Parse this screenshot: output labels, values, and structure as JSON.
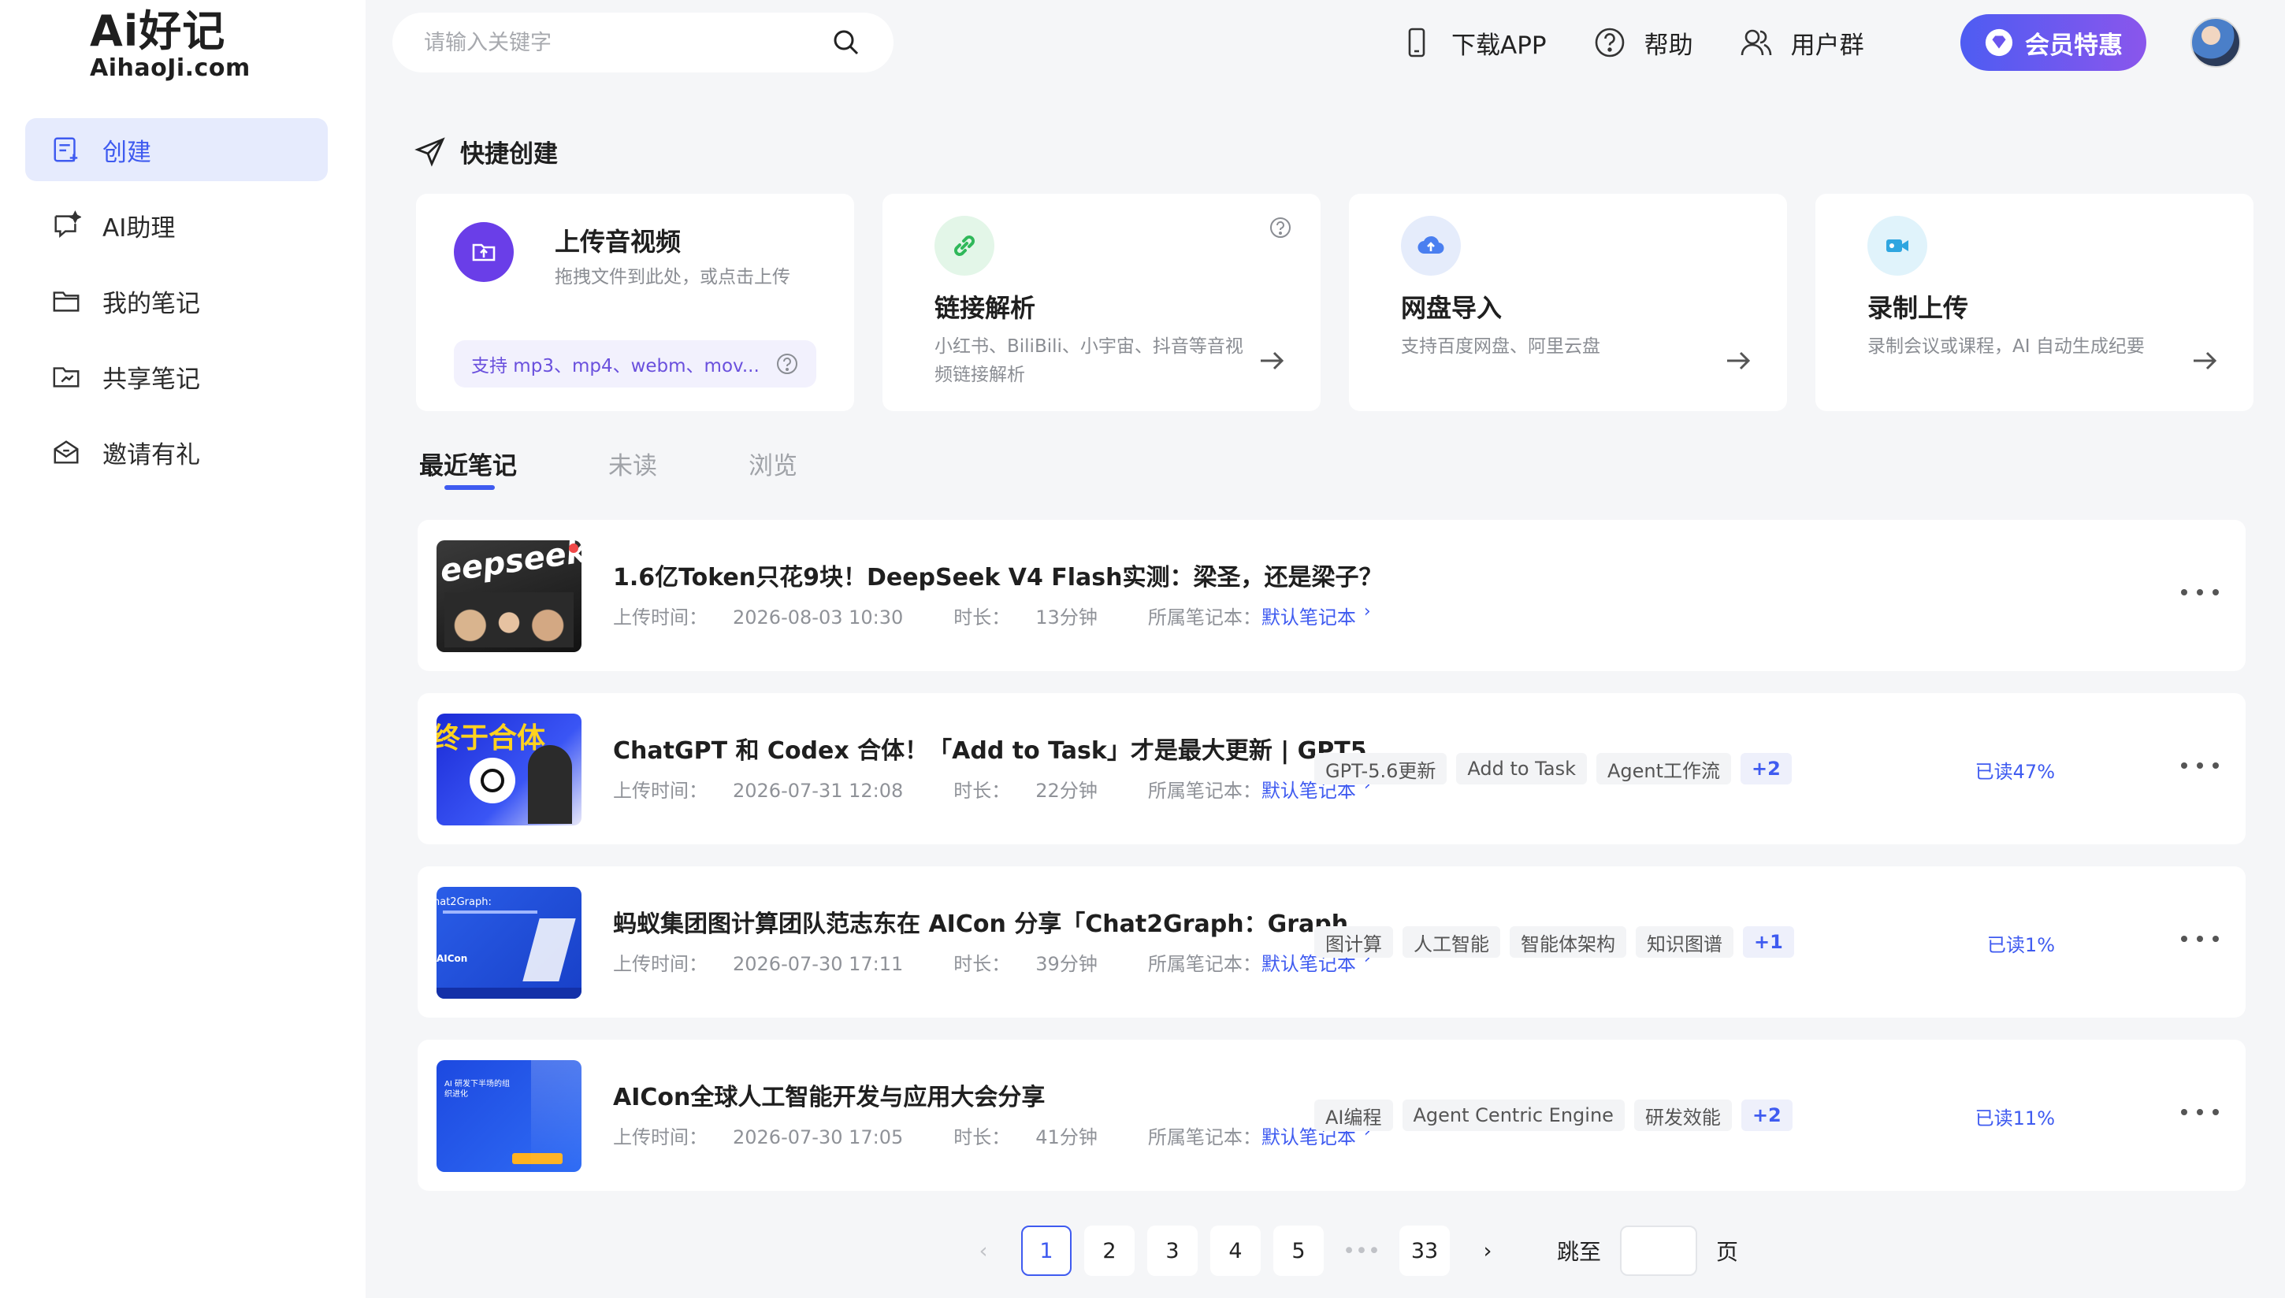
{
  "logo": {
    "top": "Ai好记",
    "bottom": "AihaoJi.com"
  },
  "sidebar": {
    "items": [
      {
        "label": "创建",
        "icon": "create-icon",
        "active": true
      },
      {
        "label": "AI助理",
        "icon": "ai-chat-icon"
      },
      {
        "label": "我的笔记",
        "icon": "folder-icon"
      },
      {
        "label": "共享笔记",
        "icon": "shared-folder-icon"
      },
      {
        "label": "邀请有礼",
        "icon": "gift-mail-icon"
      }
    ]
  },
  "header": {
    "search_placeholder": "请输入关键字",
    "download": "下载APP",
    "help": "帮助",
    "community": "用户群",
    "vip": "会员特惠"
  },
  "quick_create": {
    "title": "快捷创建",
    "cards": [
      {
        "title": "上传音视频",
        "desc": "拖拽文件到此处，或点击上传",
        "formats": "支持 mp3、mp4、webm、mov..."
      },
      {
        "title": "链接解析",
        "desc_line1": "小红书、BiliBili、小宇宙、抖音等音视",
        "desc_line2": "频链接解析"
      },
      {
        "title": "网盘导入",
        "desc": "支持百度网盘、阿里云盘"
      },
      {
        "title": "录制上传",
        "desc": "录制会议或课程，AI 自动生成纪要"
      }
    ]
  },
  "tabs": [
    {
      "label": "最近笔记",
      "active": true
    },
    {
      "label": "未读"
    },
    {
      "label": "浏览"
    }
  ],
  "labels": {
    "upload_time": "上传时间：",
    "duration": "时长：",
    "notebook": "所属笔记本："
  },
  "notes": [
    {
      "title": "1.6亿Token只花9块！DeepSeek V4 Flash实测：梁圣，还是梁子？",
      "time": "2026-08-03 10:30",
      "duration": "13分钟",
      "notebook": "默认笔记本",
      "tags": [],
      "progress": "",
      "thumb_text": "eepseek"
    },
    {
      "title": "ChatGPT 和 Codex 合体！「Add to Task」才是最大更新 | GPT5....",
      "time": "2026-07-31 12:08",
      "duration": "22分钟",
      "notebook": "默认笔记本",
      "tags": [
        "GPT-5.6更新",
        "Add to Task",
        "Agent工作流"
      ],
      "more": "+2",
      "progress": "已读47%",
      "thumb_text": "终于合体"
    },
    {
      "title": "蚂蚁集团图计算团队范志东在 AICon 分享「Chat2Graph：Graph ...",
      "time": "2026-07-30 17:11",
      "duration": "39分钟",
      "notebook": "默认笔记本",
      "tags": [
        "图计算",
        "人工智能",
        "智能体架构",
        "知识图谱"
      ],
      "more": "+1",
      "progress": "已读1%",
      "thumb_text": "hat2Graph:"
    },
    {
      "title": "AICon全球人工智能开发与应用大会分享",
      "time": "2026-07-30 17:05",
      "duration": "41分钟",
      "notebook": "默认笔记本",
      "tags": [
        "AI编程",
        "Agent Centric Engine",
        "研发效能"
      ],
      "more": "+2",
      "progress": "已读11%",
      "thumb_text": "AI 研发下半场的组织进化"
    }
  ],
  "pagination": {
    "pages": [
      "1",
      "2",
      "3",
      "4",
      "5"
    ],
    "ellipsis": "•••",
    "last": "33",
    "current": "1",
    "jump_label": "跳至",
    "page_unit": "页"
  },
  "colors": {
    "accent": "#3f5bf0",
    "vip_start": "#4e5cf2",
    "vip_end": "#8a56ec"
  }
}
